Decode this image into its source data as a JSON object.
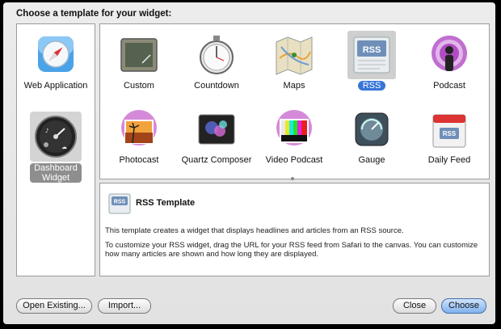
{
  "dialog": {
    "heading": "Choose a template for your widget:"
  },
  "categories": [
    {
      "label": "Web Application",
      "icon": "safari-compass-icon",
      "selected": false
    },
    {
      "label": "Dashboard Widget",
      "icon": "dashboard-gauge-icon",
      "selected": true
    }
  ],
  "templates": [
    {
      "label": "Custom",
      "icon": "chalkboard-icon"
    },
    {
      "label": "Countdown",
      "icon": "stopwatch-icon"
    },
    {
      "label": "Maps",
      "icon": "map-icon"
    },
    {
      "label": "RSS",
      "icon": "rss-icon",
      "selected": true
    },
    {
      "label": "Podcast",
      "icon": "podcast-icon"
    },
    {
      "label": "Photocast",
      "icon": "photocast-icon"
    },
    {
      "label": "Quartz Composer",
      "icon": "quartz-composer-icon"
    },
    {
      "label": "Video Podcast",
      "icon": "video-podcast-icon"
    },
    {
      "label": "Gauge",
      "icon": "gauge-icon"
    },
    {
      "label": "Daily Feed",
      "icon": "daily-feed-icon"
    }
  ],
  "description": {
    "title": "RSS Template",
    "para1": "This template creates a widget that displays headlines and articles from an RSS source.",
    "para2": "To customize your RSS widget, drag the URL for your RSS feed from Safari to the canvas. You can customize how many articles are shown and how long they are displayed."
  },
  "buttons": {
    "open_existing": "Open Existing...",
    "import": "Import...",
    "close": "Close",
    "choose": "Choose"
  }
}
